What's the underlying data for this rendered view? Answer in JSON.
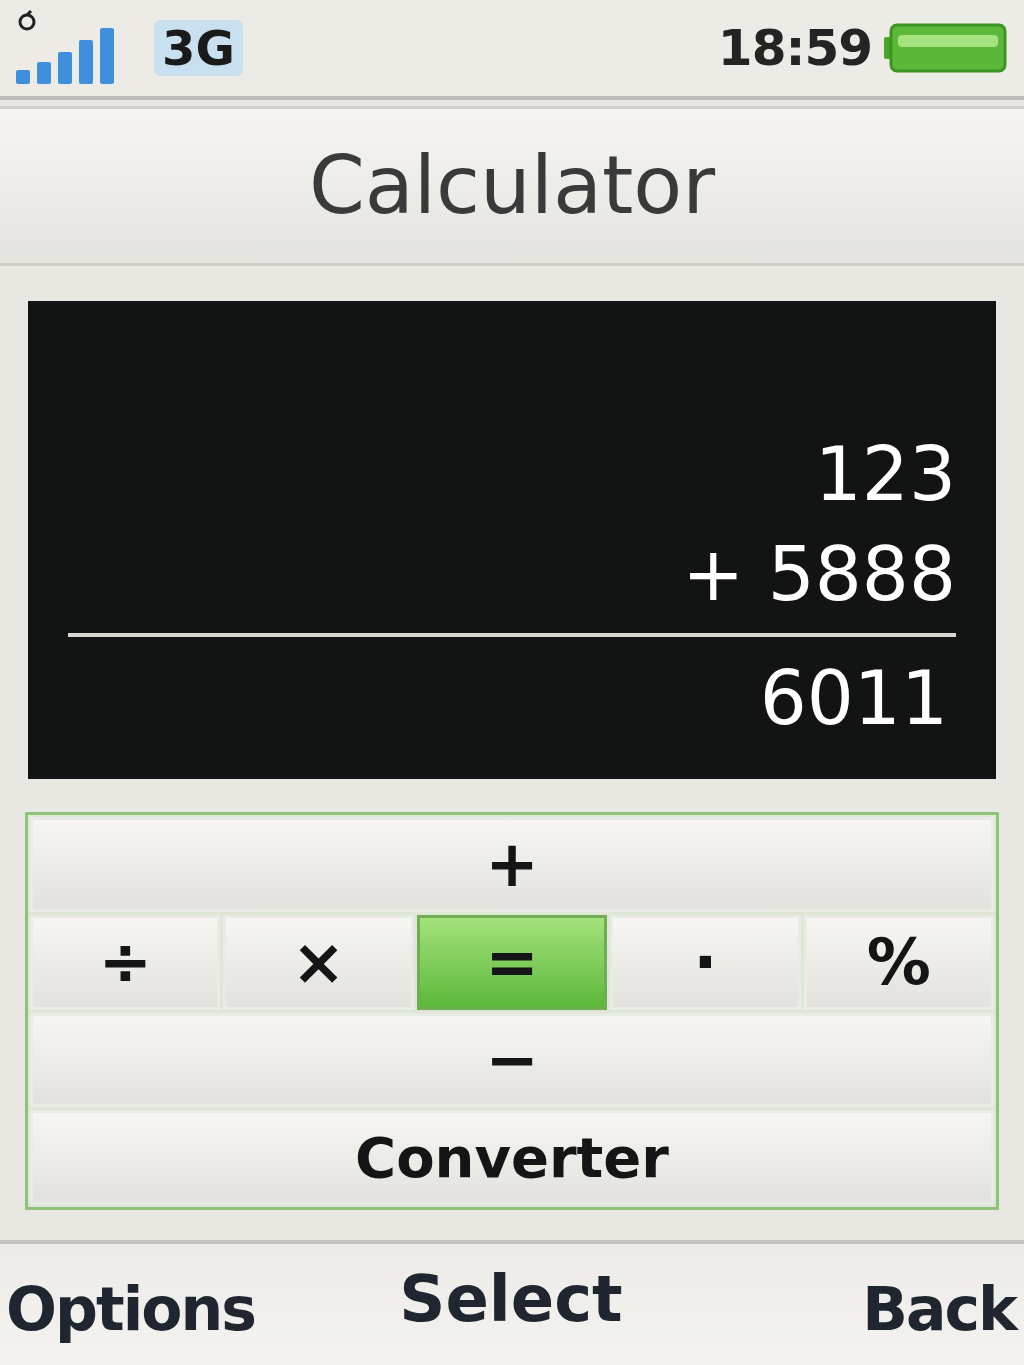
{
  "status_bar": {
    "network": "3G",
    "time": "18:59"
  },
  "title": "Calculator",
  "display": {
    "operand": "123",
    "operation": "+ 5888",
    "result": "6011"
  },
  "keypad": {
    "rows": [
      {
        "keys": [
          {
            "label": "+",
            "kind": "symbol",
            "selected": false
          }
        ]
      },
      {
        "keys": [
          {
            "label": "÷",
            "kind": "symbol",
            "selected": false
          },
          {
            "label": "×",
            "kind": "symbol",
            "selected": false
          },
          {
            "label": "=",
            "kind": "symbol",
            "selected": true
          },
          {
            "label": "·",
            "kind": "symbol",
            "selected": false
          },
          {
            "label": "%",
            "kind": "symbol",
            "selected": false
          }
        ]
      },
      {
        "keys": [
          {
            "label": "−",
            "kind": "symbol",
            "selected": false
          }
        ]
      },
      {
        "keys": [
          {
            "label": "Converter",
            "kind": "word",
            "selected": false
          }
        ]
      }
    ]
  },
  "softkeys": {
    "left": "Options",
    "center": "Select",
    "right": "Back"
  }
}
